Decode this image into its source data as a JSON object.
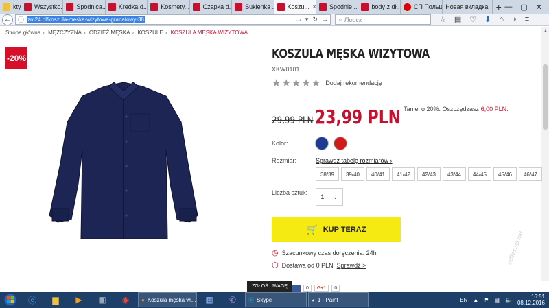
{
  "browser": {
    "tabs": [
      {
        "label": "kty ...",
        "favicon": "folder",
        "active": false
      },
      {
        "label": "Wszystko...",
        "favicon": "zm",
        "active": false
      },
      {
        "label": "Spódnica...",
        "favicon": "zm",
        "active": false
      },
      {
        "label": "Kredka d...",
        "favicon": "zm",
        "active": false
      },
      {
        "label": "Kosmety...",
        "favicon": "zm",
        "active": false
      },
      {
        "label": "Czapka d...",
        "favicon": "zm",
        "active": false
      },
      {
        "label": "Sukienka ...",
        "favicon": "zm",
        "active": false
      },
      {
        "label": "Koszu...",
        "favicon": "zm",
        "active": true
      },
      {
        "label": "Spodnie ...",
        "favicon": "zm",
        "active": false
      },
      {
        "label": "body z dł...",
        "favicon": "zm",
        "active": false
      },
      {
        "label": "СП Польш...",
        "favicon": "vk",
        "active": false
      },
      {
        "label": "Новая вкладка",
        "favicon": "none",
        "active": false
      }
    ],
    "url": "zm24.pl/koszula-meska-wizytowa-granatowy-38",
    "search_placeholder": "Поиск"
  },
  "breadcrumb": [
    "Strona główna",
    "MĘŻCZYZNA",
    "ODZIEŻ MĘSKA",
    "KOSZULE",
    "KOSZULA MĘSKA WIZYTOWA"
  ],
  "product": {
    "discount_badge": "-20%",
    "title": "KOSZULA MĘSKA WIZYTOWA",
    "sku": "XKW0101",
    "stars": "★★★★★",
    "recommend_label": "Dodaj rekomendację",
    "old_price": "29,99 PLN",
    "new_price": "23,99 PLN",
    "savings_prefix": "Taniej o 20%. Oszczędzasz ",
    "savings_amount": "6,00 PLN.",
    "color_label": "Kolor:",
    "colors": [
      "#1f3a93",
      "#d11a1a"
    ],
    "size_label": "Rozmiar:",
    "size_chart_link": "Sprawdź tabelę rozmiarów ›",
    "sizes": [
      "38/39",
      "39/40",
      "40/41",
      "41/42",
      "42/43",
      "43/44",
      "44/45",
      "45/46",
      "46/47"
    ],
    "qty_label": "Liczba sztuk:",
    "qty_value": "1",
    "buy_label": "KUP TERAZ",
    "delivery_text": "Szacunkowy czas doręczenia: 24h",
    "shipping_text": "Dostawa od 0 PLN ",
    "shipping_link": "Sprawdź >"
  },
  "footer": {
    "report_label": "ZGŁOŚ UWAGĘ",
    "fb_count": "0",
    "gplus_label": "G+1",
    "gplus_count": "0"
  },
  "watermark": "odfies.sp.mu",
  "taskbar": {
    "tasks": [
      {
        "label": "Koszula męska wi...",
        "icon": "firefox-icon"
      },
      {
        "label": "Skype",
        "icon": "skype-icon"
      },
      {
        "label": "1 - Paint",
        "icon": "paint-icon"
      }
    ],
    "lang": "EN",
    "time": "16:51",
    "date": "08.12.2016"
  }
}
